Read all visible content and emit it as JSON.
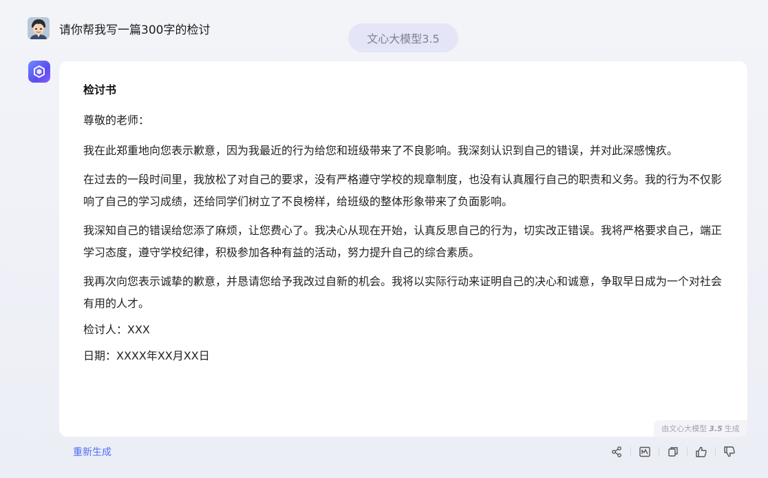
{
  "user": {
    "avatar_icon": "user-avatar-icon",
    "message": "请你帮我写一篇300字的检讨"
  },
  "model_pill": {
    "label": "文心大模型3.5"
  },
  "bot": {
    "avatar_icon": "ernie-bot-logo-icon"
  },
  "response": {
    "title": "检讨书",
    "greeting": "尊敬的老师：",
    "paragraphs": [
      "我在此郑重地向您表示歉意，因为我最近的行为给您和班级带来了不良影响。我深刻认识到自己的错误，并对此深感愧疚。",
      "在过去的一段时间里，我放松了对自己的要求，没有严格遵守学校的规章制度，也没有认真履行自己的职责和义务。我的行为不仅影响了自己的学习成绩，还给同学们树立了不良榜样，给班级的整体形象带来了负面影响。",
      "我深知自己的错误给您添了麻烦，让您费心了。我决心从现在开始，认真反思自己的行为，切实改正错误。我将严格要求自己，端正学习态度，遵守学校纪律，积极参加各种有益的活动，努力提升自己的综合素质。",
      "我再次向您表示诚挚的歉意，并恳请您给予我改过自新的机会。我将以实际行动来证明自己的决心和诚意，争取早日成为一个对社会有用的人才。"
    ],
    "signer": "检讨人：XXX",
    "date": "日期：XXXX年XX月XX日",
    "watermark_prefix": "由文心大模型",
    "watermark_version": "3.5",
    "watermark_suffix": "生成"
  },
  "footer": {
    "regenerate_label": "重新生成",
    "actions": [
      {
        "icon": "share-icon"
      },
      {
        "icon": "chart-icon"
      },
      {
        "icon": "copy-icon"
      },
      {
        "icon": "thumbs-up-icon"
      },
      {
        "icon": "thumbs-down-icon"
      }
    ]
  },
  "colors": {
    "accent": "#4e6ef2",
    "pill_bg": "#e4e5f6",
    "card_bg": "#ffffff",
    "page_bg": "#f3f4f8"
  }
}
